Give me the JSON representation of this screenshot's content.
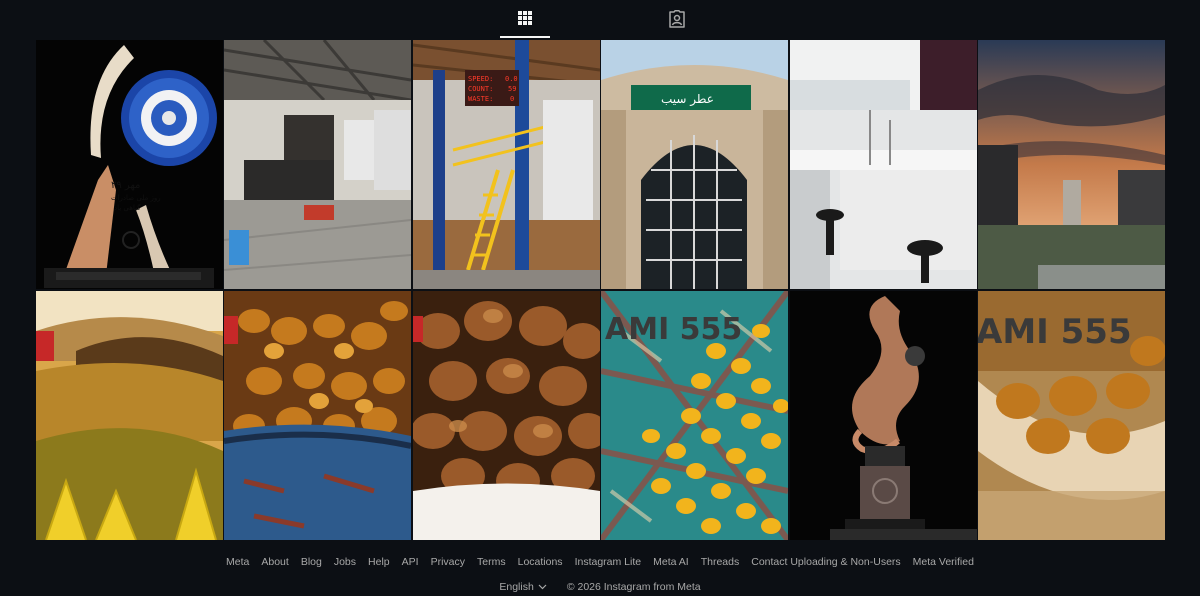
{
  "tabs": [
    {
      "icon": "grid-icon",
      "active": true
    },
    {
      "icon": "tagged-icon",
      "active": false
    }
  ],
  "posts": [
    {
      "icon": "award-trophy-plaque",
      "lines": [
        "۲۹ مهر",
        "روز ملی صادرات",
        "گیاهی باد"
      ]
    },
    {
      "icon": "factory-interior"
    },
    {
      "icon": "factory-machine",
      "lines": [
        "SPEED:",
        "COUNT:",
        "WASTE:",
        "0.0",
        "59",
        "0"
      ]
    },
    {
      "icon": "building-facade",
      "lines": [
        "عطر سیب"
      ]
    },
    {
      "icon": "laboratory"
    },
    {
      "icon": "monument-sunset"
    },
    {
      "icon": "golden-hills"
    },
    {
      "icon": "raisins-bowl"
    },
    {
      "icon": "raisins-closeup"
    },
    {
      "icon": "golden-raisins",
      "lines": [
        "AMI 555"
      ]
    },
    {
      "icon": "bronze-trophy"
    },
    {
      "icon": "raisins-spoon",
      "lines": [
        "AMI 555"
      ]
    }
  ],
  "footer": {
    "links": [
      "Meta",
      "About",
      "Blog",
      "Jobs",
      "Help",
      "API",
      "Privacy",
      "Terms",
      "Locations",
      "Instagram Lite",
      "Meta AI",
      "Threads",
      "Contact Uploading & Non-Users",
      "Meta Verified"
    ],
    "language": "English",
    "copyright": "© 2026 Instagram from Meta"
  }
}
